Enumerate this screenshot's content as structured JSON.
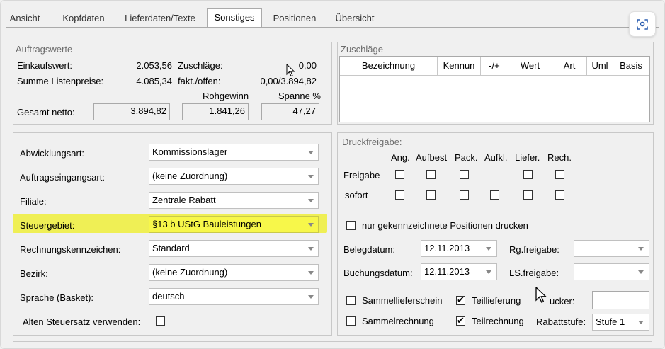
{
  "tabs": [
    "Ansicht",
    "Kopfdaten",
    "Lieferdaten/Texte",
    "Sonstiges",
    "Positionen",
    "Übersicht"
  ],
  "active_tab": "Sonstiges",
  "auftragswerte": {
    "title": "Auftragswerte",
    "einkaufswert_label": "Einkaufswert:",
    "einkaufswert": "2.053,56",
    "zuschlaege_label": "Zuschläge:",
    "zuschlaege": "0,00",
    "listenpreise_label": "Summe Listenpreise:",
    "listenpreise": "4.085,34",
    "fakt_label": "fakt./offen:",
    "fakt": "0,00/3.894,82",
    "rohgewinn_label": "Rohgewinn",
    "spanne_label": "Spanne %",
    "gesamt_label": "Gesamt netto:",
    "gesamt": "3.894,82",
    "rohgewinn": "1.841,26",
    "spanne": "47,27"
  },
  "zuschlaege_grid": {
    "title": "Zuschläge",
    "columns": [
      "Bezeichnung",
      "Kennun",
      "-/+",
      "Wert",
      "Art",
      "Uml",
      "Basis"
    ]
  },
  "fields": {
    "abwicklungsart_label": "Abwicklungsart:",
    "abwicklungsart": "Kommissionslager",
    "auftragseingangsart_label": "Auftragseingangsart:",
    "auftragseingangsart": "(keine Zuordnung)",
    "filiale_label": "Filiale:",
    "filiale": "Zentrale Rabatt",
    "steuergebiet_label": "Steuergebiet:",
    "steuergebiet": "§13 b UStG Bauleistungen",
    "rechnungskennzeichen_label": "Rechnungskennzeichen:",
    "rechnungskennzeichen": "Standard",
    "bezirk_label": "Bezirk:",
    "bezirk": "(keine Zuordnung)",
    "sprache_label": "Sprache (Basket):",
    "sprache": "deutsch",
    "alten_steuersatz_label": "Alten Steuersatz verwenden:"
  },
  "druck": {
    "title": "Druckfreigabe:",
    "cols": [
      "Ang.",
      "Aufbest",
      "Pack.",
      "Aufkl.",
      "Liefer.",
      "Rech."
    ],
    "freigabe_label": "Freigabe",
    "sofort_label": "sofort",
    "nur_gekennzeichnete_label": "nur gekennzeichnete Positionen drucken",
    "belegdatum_label": "Belegdatum:",
    "belegdatum": "12.11.2013",
    "rgfreigabe_label": "Rg.freigabe:",
    "buchungsdatum_label": "Buchungsdatum:",
    "buchungsdatum": "12.11.2013",
    "lsfreigabe_label": "LS.freigabe:",
    "sammellieferschein_label": "Sammellieferschein",
    "teillieferung_label": "Teillieferung",
    "drucker_label": "ucker:",
    "sammelrechnung_label": "Sammelrechnung",
    "teilrechnung_label": "Teilrechnung",
    "rabattstufe_label": "Rabattstufe:",
    "rabattstufe": "Stufe 1"
  }
}
